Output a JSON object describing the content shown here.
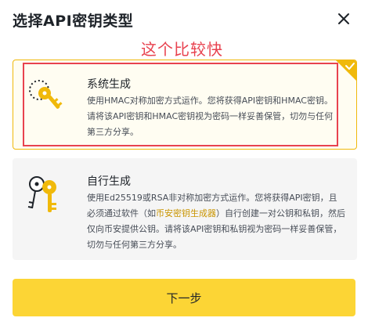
{
  "dialog": {
    "title": "选择API密钥类型",
    "close_icon": "close-icon"
  },
  "annotation": {
    "text": "这个比较快",
    "color": "#e8424f"
  },
  "options": [
    {
      "title": "系统生成",
      "description": "使用HMAC对称加密方式运作。您将获得API密钥和HMAC密钥。请将该API密钥和HMAC密钥视为密码一样妥善保管，切勿与任何第三方分享。",
      "icon": "key-icon",
      "selected": true
    },
    {
      "title": "自行生成",
      "description_before": "使用Ed25519或RSA非对称加密方式运作。您将获得API密钥，且必须通过软件（如",
      "description_link": "币安密钥生成器",
      "description_after": "）自行创建一对公钥和私钥，然后仅向币安提供公钥。请将该API密钥和私钥视为密码一样妥善保管，切勿与任何第三方分享。",
      "icon": "keys-icon",
      "selected": false
    }
  ],
  "footer": {
    "next_label": "下一步"
  },
  "colors": {
    "accent": "#f0b90b",
    "button": "#fcd535",
    "link": "#c99400"
  }
}
